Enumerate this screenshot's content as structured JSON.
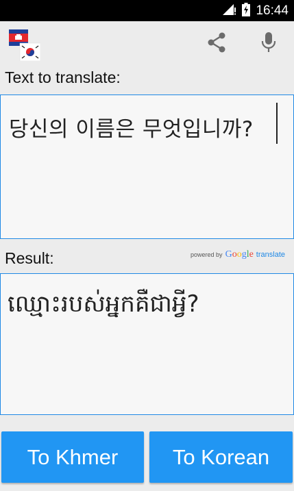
{
  "status_bar": {
    "time": "16:44",
    "icons": [
      "signal-icon",
      "battery-charging-icon"
    ]
  },
  "toolbar": {
    "app_icon": "cambodia-korea-flags-icon",
    "actions": [
      "share-icon",
      "microphone-icon"
    ]
  },
  "source": {
    "label": "Text to translate:",
    "text": "당신의 이름은 무엇입니까?"
  },
  "result": {
    "label": "Result:",
    "powered_by": "powered by",
    "google": "Google",
    "translate": "translate",
    "text": "ឈ្មោះរបស់អ្នកគឺជាអ្វី?"
  },
  "buttons": {
    "to_khmer": "To Khmer",
    "to_korean": "To Korean"
  },
  "colors": {
    "accent": "#2196f3",
    "field_border": "#1e88e5",
    "background": "#ececec",
    "status_bar": "#000000"
  }
}
